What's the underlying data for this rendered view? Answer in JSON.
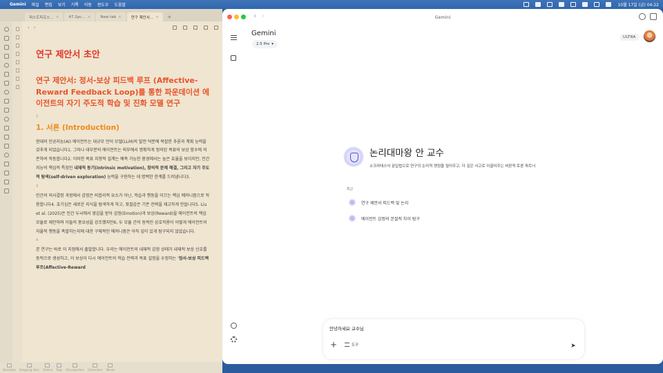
{
  "menubar": {
    "app_name": "Gemini",
    "items": [
      "파일",
      "편집",
      "보기",
      "기록",
      "이동",
      "윈도우",
      "도움말"
    ],
    "datetime": "10월 17일 (금) 04:22"
  },
  "editor": {
    "tabs": [
      {
        "label": "퍼스트피프스…"
      },
      {
        "label": "47.2pc…"
      },
      {
        "label": "New tab"
      },
      {
        "label": "연구 제안서…"
      }
    ],
    "doc_title": "연구 제안서 초안",
    "subtitle": "연구 제안서: 정서-보상 피드백 루프 (Affective-Reward Feedback Loop)를 통한 파운데이션 에이전트의 자기 주도적 학습 및 진화 모델 연구",
    "sep1": "2",
    "section_title": "1. 서론 (Introduction)",
    "para1_a": "현대의 인공지능(AI) 에이전트는 대규모 언어 모델(LLM)의 발전 덕분에 복잡한 추론과 계획 능력을 갖추게 되었습니다1. 그러나 대부분의 에이전트는 외부에서 명확하게 정의된 목표와 보상 함수에 의존하여 작동합니다2. 이러한 목표 지향적 설계는 예측 가능한 환경에서는 높은 효율을 보이지만, 인간 지능의 핵심적 특징인 ",
    "para1_b": "내재적 동기(intrinsic motivation), 창의적 문제 해결, 그리고 자기 주도적 탐색(self-driven exploration)",
    "para1_c": " 능력을 구현하는 데 명백한 한계를 드러냅니다3.",
    "sep2": "3",
    "para2": "인간의 의사결정 과정에서 감정은 비합리적 요소가 아닌, 학습과 행동을 이끄는 핵심 메커니즘으로 작용합니다4. 호기심은 새로운 지식을 탐색하게 하고, 좌절감은 기존 전략을 재고하게 만듭니다5. Liu et al. (2025)은 인간 두뇌에서 영감을 받아 감정(Emotion)과 보상(Reward)을 에이전트의 핵심 모듈로 제안하며 이들의 중요성을 강조했지만6, 두 모듈 간의 동적인 상호작용이 어떻게 에이전트의 자율적 행동을 촉발하는지에 대한 구체적인 메커니즘은 아직 깊이 있게 탐구되지 않았습니다.",
    "sep3": "4",
    "para3_a": "본 연구는 바로 이 지점에서 출발합니다. 우리는 에이전트의 내재적 감정 상태가 내재적 보상 신호를 동적으로 생성하고, 이 보상이 다시 에이전트의 학습 전략과 목표 설정을 수정하는 ",
    "para3_b": "'정서-보상 피드백 루프(Affective-Reward",
    "statusbar": [
      "Backlinks",
      "Outgoing links",
      "Outline",
      "Tags",
      "All properties",
      "Characters",
      "Words"
    ]
  },
  "gemini": {
    "window_title": "Gemini",
    "brand": "Gemini",
    "model": "2.5 Pro",
    "plan_badge": "ULTRA",
    "gem_name": "논리대마왕 안 교수",
    "gem_description": "소크라테스식 문답법으로 연구의 논리적 맹점을 짚어주고, 더 깊은 사고로 이끌어주는 비판적 토론 파트너",
    "recent_label": "최근",
    "recent_items": [
      {
        "label": "연구 제안서 피드백 및 논리"
      },
      {
        "label": "에이전트 감정의 본질적 차이 탐구"
      }
    ],
    "input_value": "안녕하세요 교수님",
    "tools_label": "도구"
  }
}
